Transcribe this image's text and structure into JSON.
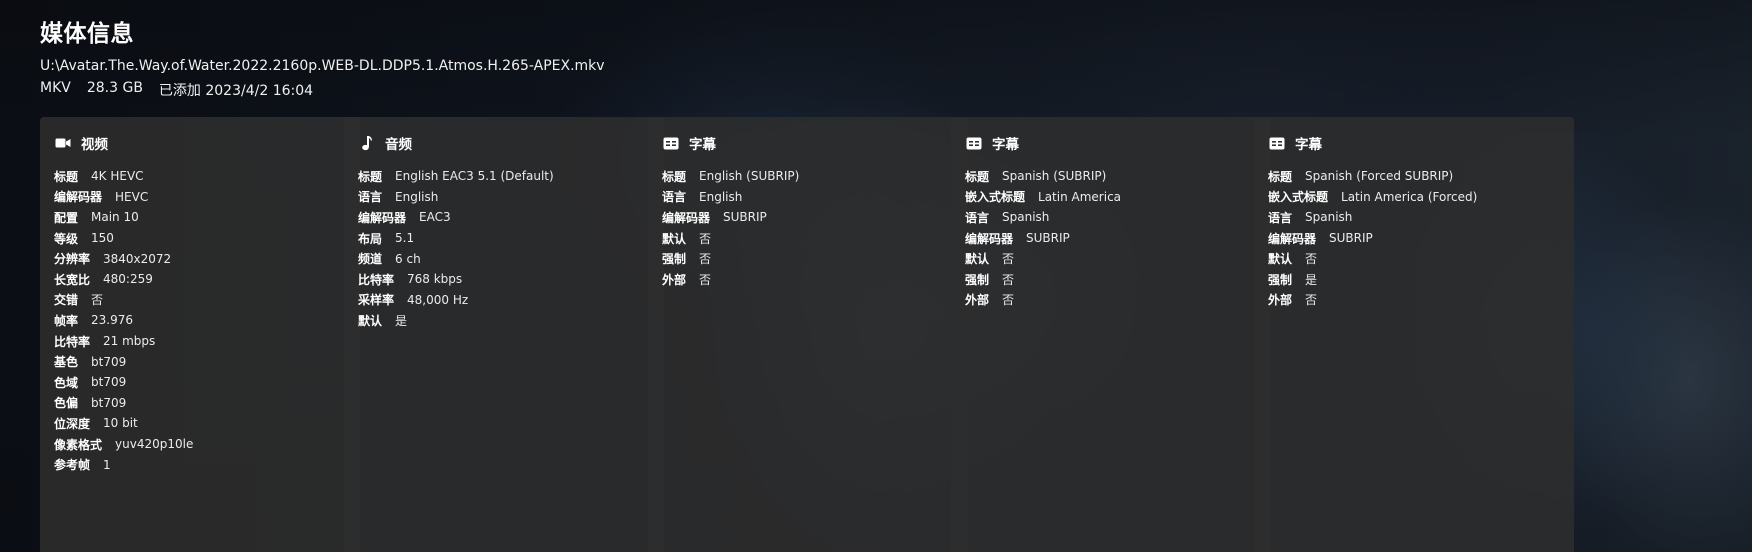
{
  "header": {
    "title": "媒体信息",
    "path": "U:\\Avatar.The.Way.of.Water.2022.2160p.WEB-DL.DDP5.1.Atmos.H.265-APEX.mkv",
    "container": "MKV",
    "size": "28.3 GB",
    "added": "已添加 2023/4/2 16:04"
  },
  "cards": [
    {
      "icon": "video-camera-icon",
      "title": "视频",
      "rows": [
        {
          "k": "标题",
          "v": "4K HEVC"
        },
        {
          "k": "编解码器",
          "v": "HEVC"
        },
        {
          "k": "配置",
          "v": "Main 10"
        },
        {
          "k": "等级",
          "v": "150"
        },
        {
          "k": "分辨率",
          "v": "3840x2072"
        },
        {
          "k": "长宽比",
          "v": "480:259"
        },
        {
          "k": "交错",
          "v": "否"
        },
        {
          "k": "帧率",
          "v": "23.976"
        },
        {
          "k": "比特率",
          "v": "21 mbps"
        },
        {
          "k": "基色",
          "v": "bt709"
        },
        {
          "k": "色域",
          "v": "bt709"
        },
        {
          "k": "色偏",
          "v": "bt709"
        },
        {
          "k": "位深度",
          "v": "10 bit"
        },
        {
          "k": "像素格式",
          "v": "yuv420p10le"
        },
        {
          "k": "参考帧",
          "v": "1"
        }
      ]
    },
    {
      "icon": "music-note-icon",
      "title": "音频",
      "rows": [
        {
          "k": "标题",
          "v": "English EAC3 5.1 (Default)"
        },
        {
          "k": "语言",
          "v": "English"
        },
        {
          "k": "编解码器",
          "v": "EAC3"
        },
        {
          "k": "布局",
          "v": "5.1"
        },
        {
          "k": "频道",
          "v": "6 ch"
        },
        {
          "k": "比特率",
          "v": "768 kbps"
        },
        {
          "k": "采样率",
          "v": "48,000 Hz"
        },
        {
          "k": "默认",
          "v": "是"
        }
      ]
    },
    {
      "icon": "subtitles-icon",
      "title": "字幕",
      "rows": [
        {
          "k": "标题",
          "v": "English (SUBRIP)"
        },
        {
          "k": "语言",
          "v": "English"
        },
        {
          "k": "编解码器",
          "v": "SUBRIP"
        },
        {
          "k": "默认",
          "v": "否"
        },
        {
          "k": "强制",
          "v": "否"
        },
        {
          "k": "外部",
          "v": "否"
        }
      ]
    },
    {
      "icon": "subtitles-icon",
      "title": "字幕",
      "rows": [
        {
          "k": "标题",
          "v": "Spanish (SUBRIP)"
        },
        {
          "k": "嵌入式标题",
          "v": "Latin America"
        },
        {
          "k": "语言",
          "v": "Spanish"
        },
        {
          "k": "编解码器",
          "v": "SUBRIP"
        },
        {
          "k": "默认",
          "v": "否"
        },
        {
          "k": "强制",
          "v": "否"
        },
        {
          "k": "外部",
          "v": "否"
        }
      ]
    },
    {
      "icon": "subtitles-icon",
      "title": "字幕",
      "rows": [
        {
          "k": "标题",
          "v": "Spanish (Forced SUBRIP)"
        },
        {
          "k": "嵌入式标题",
          "v": "Latin America (Forced)"
        },
        {
          "k": "语言",
          "v": "Spanish"
        },
        {
          "k": "编解码器",
          "v": "SUBRIP"
        },
        {
          "k": "默认",
          "v": "否"
        },
        {
          "k": "强制",
          "v": "是"
        },
        {
          "k": "外部",
          "v": "否"
        }
      ]
    }
  ]
}
